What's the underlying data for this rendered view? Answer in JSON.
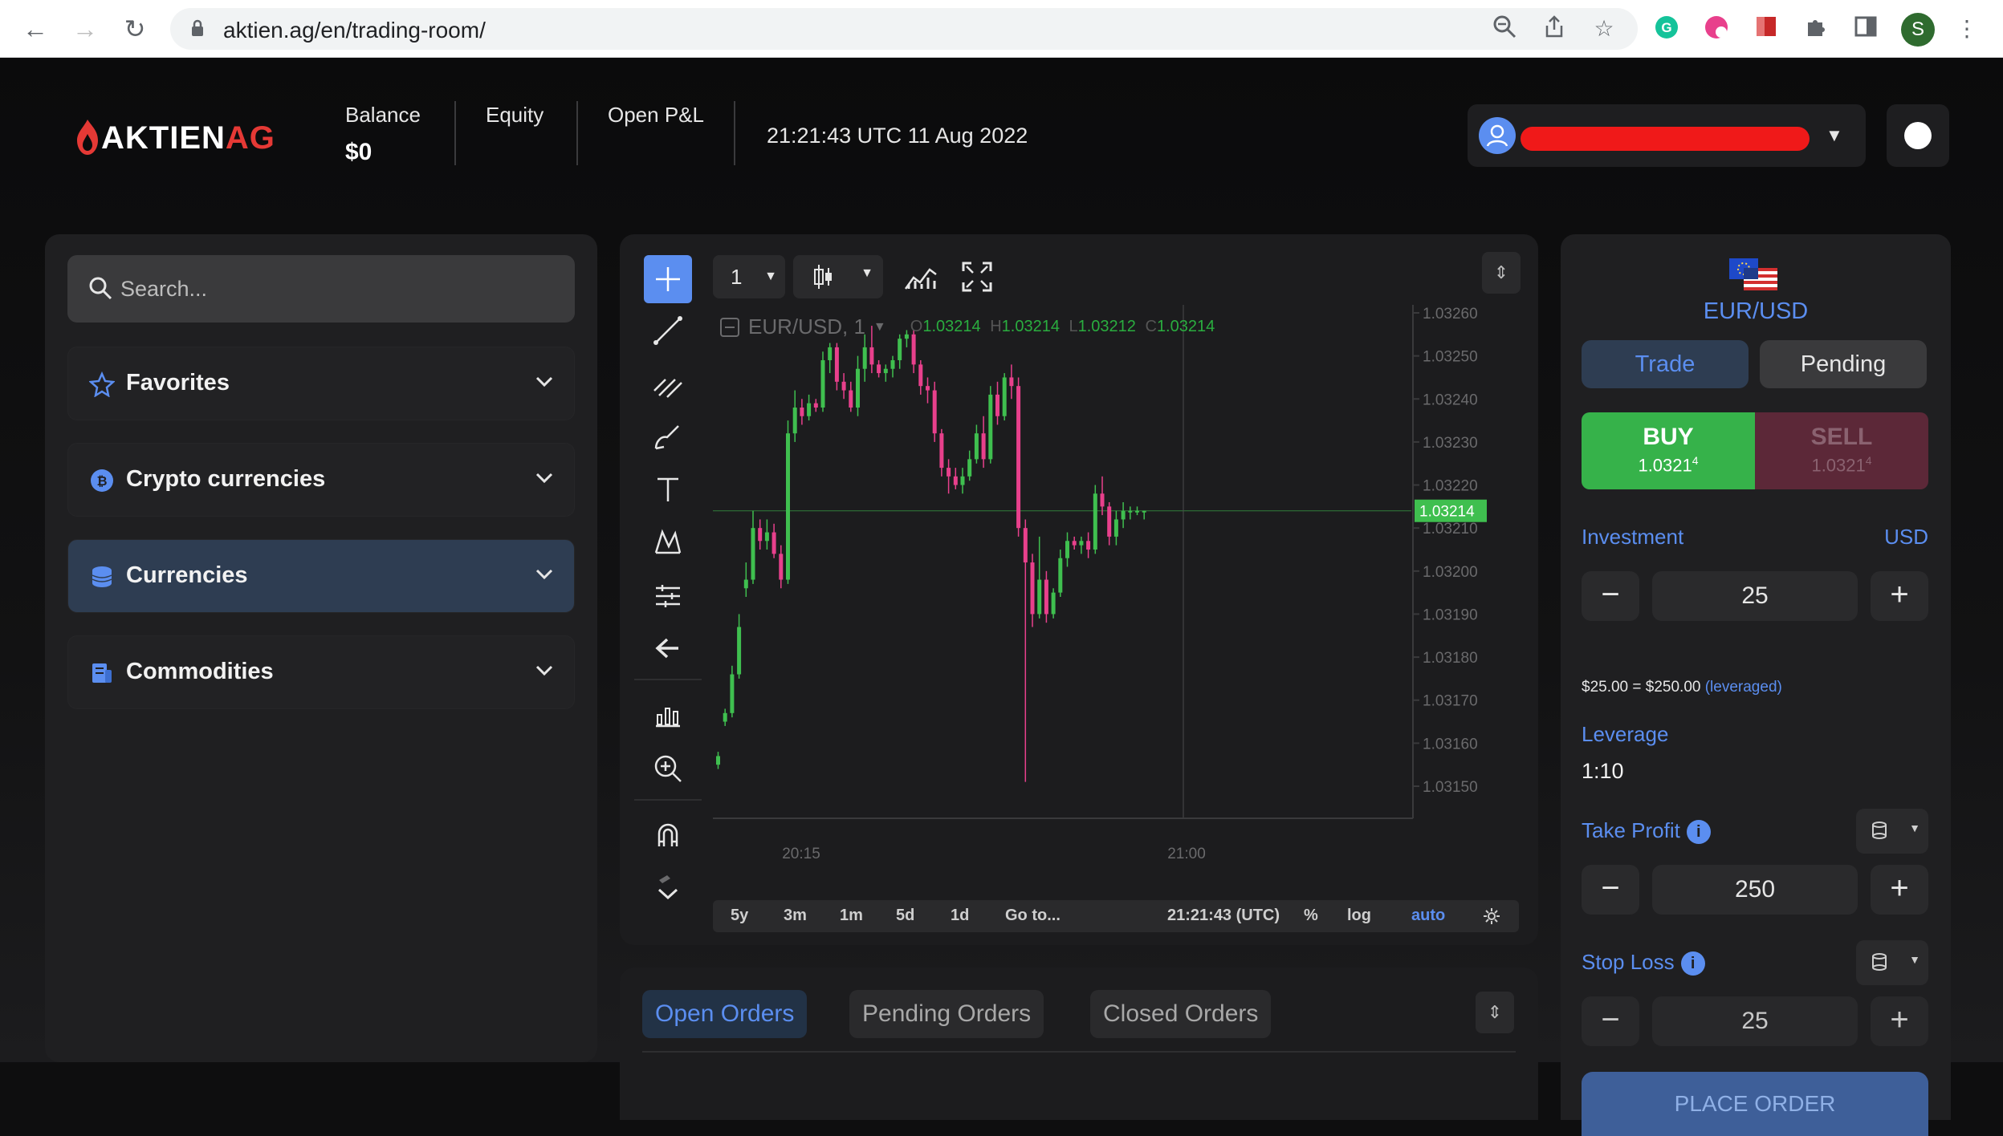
{
  "browser": {
    "url": "aktien.ag/en/trading-room/",
    "profile_initial": "S"
  },
  "header": {
    "logo_main": "AKTIEN",
    "logo_accent": "AG",
    "balance_label": "Balance",
    "balance_value": "$0",
    "equity_label": "Equity",
    "open_pl_label": "Open P&L",
    "datetime": "21:21:43 UTC 11 Aug 2022"
  },
  "sidebar": {
    "search_placeholder": "Search...",
    "categories": [
      {
        "label": "Favorites",
        "icon": "star-icon"
      },
      {
        "label": "Crypto currencies",
        "icon": "bitcoin-icon"
      },
      {
        "label": "Currencies",
        "icon": "coins-icon",
        "active": true
      },
      {
        "label": "Commodities",
        "icon": "commodities-icon"
      }
    ]
  },
  "chart": {
    "timeframe": "1",
    "legend_symbol": "EUR/USD, 1",
    "ohlc": {
      "o": "1.03214",
      "h": "1.03214",
      "l": "1.03212",
      "c": "1.03214"
    },
    "price_labels": [
      "1.03260",
      "1.03250",
      "1.03240",
      "1.03230",
      "1.03220",
      "1.03210",
      "1.03200",
      "1.03190",
      "1.03180",
      "1.03170",
      "1.03160",
      "1.03150"
    ],
    "current_price": "1.03214",
    "time_labels": [
      "20:15",
      "21:00"
    ],
    "ranges": [
      "5y",
      "3m",
      "1m",
      "5d",
      "1d"
    ],
    "goto": "Go to...",
    "clock": "21:21:43 (UTC)",
    "percent": "%",
    "log": "log",
    "auto": "auto",
    "colors": {
      "up": "#3fbf4f",
      "down": "#e8408c",
      "crosshair": "#5b8ef0"
    }
  },
  "orders": {
    "tabs": [
      "Open Orders",
      "Pending Orders",
      "Closed Orders"
    ]
  },
  "trade": {
    "pair": "EUR/USD",
    "tab_trade": "Trade",
    "tab_pending": "Pending",
    "buy_label": "BUY",
    "buy_price": "1.0321",
    "buy_sup": "4",
    "sell_label": "SELL",
    "sell_price": "1.0321",
    "sell_sup": "4",
    "investment_label": "Investment",
    "investment_currency": "USD",
    "investment_value": "25",
    "leverage_note": "$25.00 = $250.00",
    "leverage_note_suffix": "(leveraged)",
    "leverage_label": "Leverage",
    "leverage_value": "1:10",
    "take_profit_label": "Take Profit",
    "take_profit_value": "250",
    "stop_loss_label": "Stop Loss",
    "stop_loss_value": "25",
    "place_order": "PLACE ORDER"
  }
}
